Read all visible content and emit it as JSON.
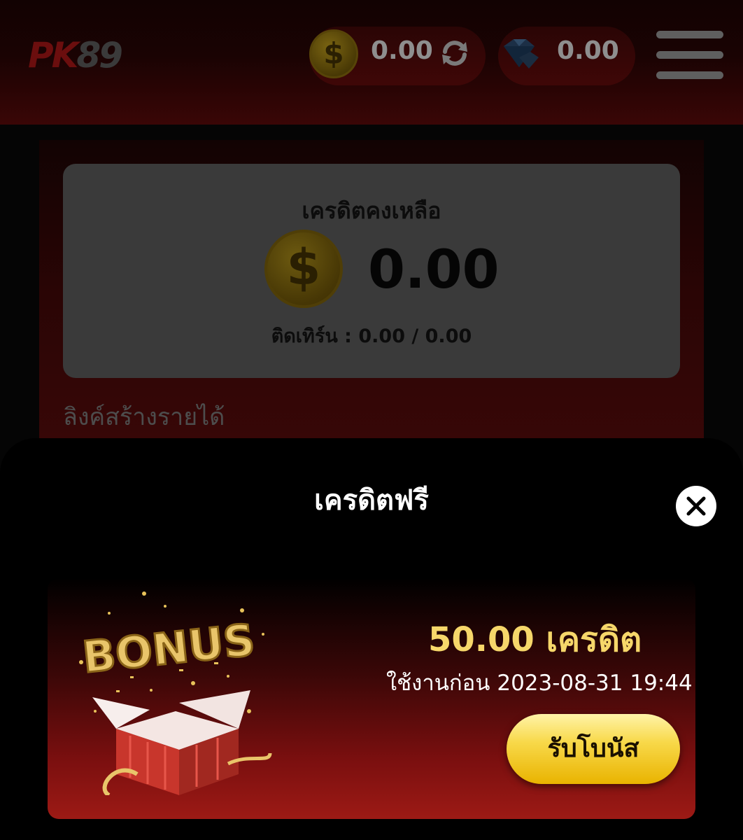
{
  "header": {
    "logo_pk": "PK",
    "logo_num": "89",
    "coin_balance": "0.00",
    "gem_balance": "0.00"
  },
  "credit_card": {
    "title": "เครดิตคงเหลือ",
    "coin_symbol": "$",
    "amount": "0.00",
    "turnover": "ติดเทิร์น : 0.00 / 0.00"
  },
  "link_label": "ลิงค์สร้างรายได้",
  "modal": {
    "title": "เครดิตฟรี",
    "bonus": {
      "amount": "50.00 เครดิต",
      "expires": "ใช้งานก่อน 2023-08-31 19:44",
      "claim_label": "รับโบนัส",
      "art_text": "BONUS"
    }
  },
  "icons": {
    "coin": "dollar-coin-icon",
    "refresh": "refresh-icon",
    "gem": "diamond-icon",
    "menu": "hamburger-menu-icon",
    "close": "close-icon"
  },
  "colors": {
    "accent_gold": "#f6d76a",
    "claim_button": "#f8d94a",
    "card_red": "#9d1a15"
  }
}
